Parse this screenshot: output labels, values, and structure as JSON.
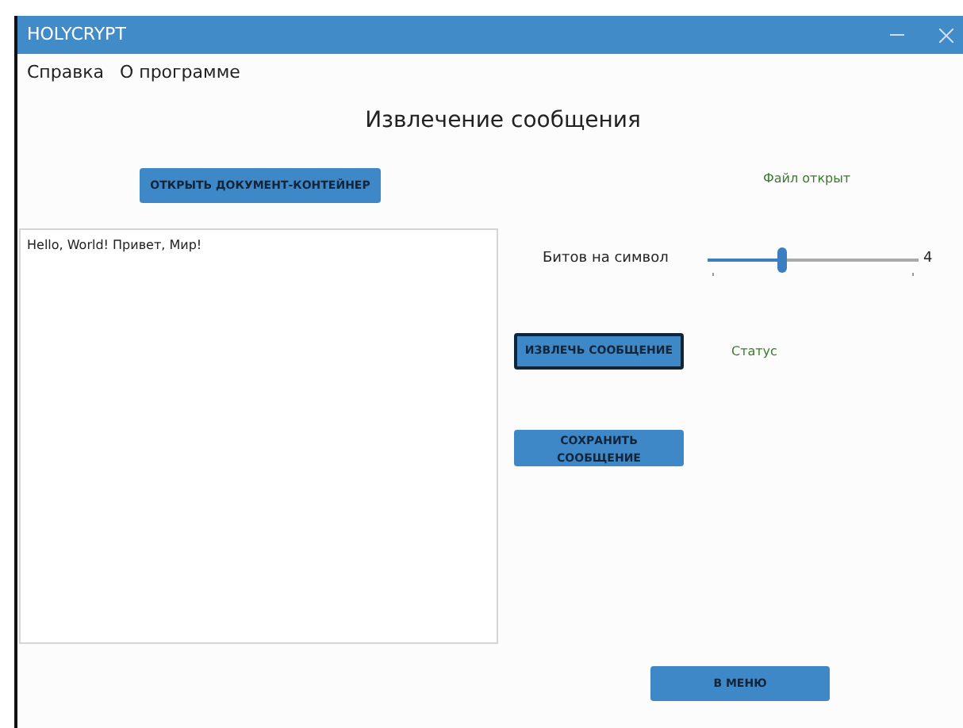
{
  "window": {
    "title": "HOLYCRYPT"
  },
  "menu": [
    "Справка",
    "О программе"
  ],
  "heading": "Извлечение сообщения",
  "open_button": {
    "label": "ОТКРЫТЬ ДОКУМЕНТ-КОНТЕЙНЕР"
  },
  "file_status": "Файл открыт",
  "message": {
    "value": "Hello, World! Привет, Мир!"
  },
  "bits_slider": {
    "label": "Битов на символ",
    "level": 0.35,
    "reading": "4"
  },
  "extract_button": {
    "label": "ИЗВЛЕЧЬ СООБЩЕНИЕ",
    "focused": true
  },
  "status": "Статус",
  "save_button": {
    "label": "СОХРАНИТЬ СООБЩЕНИЕ",
    "focused": false
  },
  "menu_button": {
    "label": "В МЕНЮ"
  }
}
